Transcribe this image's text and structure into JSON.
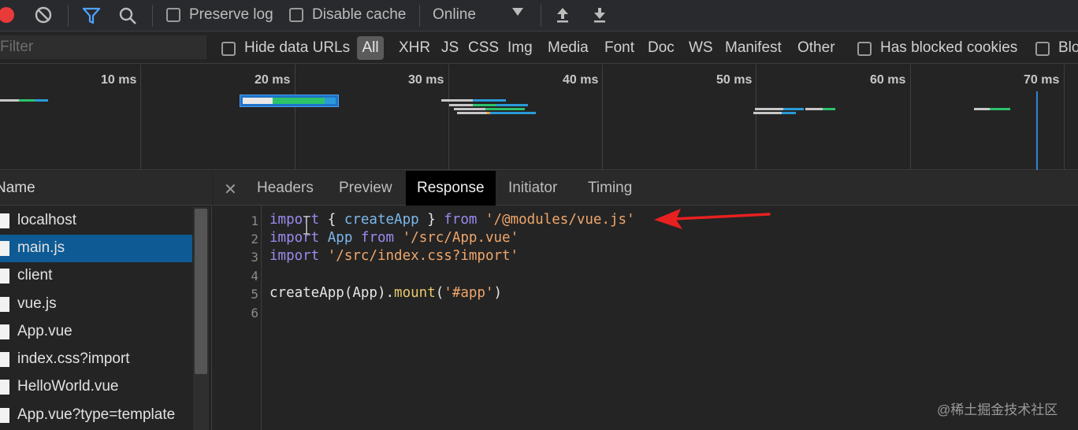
{
  "toolbar": {
    "preserve_log": "Preserve log",
    "disable_cache": "Disable cache",
    "throttling": "Online"
  },
  "filterbar": {
    "filter_placeholder": "Filter",
    "hide_data_urls": "Hide data URLs",
    "types": [
      "All",
      "XHR",
      "JS",
      "CSS",
      "Img",
      "Media",
      "Font",
      "Doc",
      "WS",
      "Manifest",
      "Other"
    ],
    "has_blocked_cookies": "Has blocked cookies",
    "blocked_requests": "Blo"
  },
  "overview": {
    "ticks": [
      "10 ms",
      "20 ms",
      "30 ms",
      "40 ms",
      "50 ms",
      "60 ms",
      "70 ms"
    ]
  },
  "requests": {
    "column_header": "Name",
    "items": [
      "localhost",
      "main.js",
      "client",
      "vue.js",
      "App.vue",
      "index.css?import",
      "HelloWorld.vue",
      "App.vue?type=template"
    ],
    "selected": "main.js"
  },
  "detail": {
    "tabs": [
      "Headers",
      "Preview",
      "Response",
      "Initiator",
      "Timing"
    ],
    "active_tab": "Response",
    "line_numbers": [
      "1",
      "2",
      "3",
      "4",
      "5",
      "6"
    ],
    "code": {
      "l1": {
        "kw1": "import",
        "p1": " { ",
        "fn1": "createApp",
        "p2": " } ",
        "kw2": "from",
        "p3": " ",
        "str1": "'/@modules/vue.js'"
      },
      "l2": {
        "kw1": "import",
        "p1": " ",
        "fn1": "App",
        "p2": " ",
        "kw2": "from",
        "p3": " ",
        "str1": "'/src/App.vue'"
      },
      "l3": {
        "kw1": "import",
        "p1": " ",
        "str1": "'/src/index.css?import'"
      },
      "l5": {
        "p1": "createApp(App).",
        "mt1": "mount",
        "p2": "(",
        "str1": "'#app'",
        "p3": ")"
      }
    }
  },
  "watermark": "@稀土掘金技术社区",
  "colors": {
    "accent_blue": "#0e5a94",
    "record_red": "#e93a3a",
    "arrow_red": "#e82020"
  }
}
